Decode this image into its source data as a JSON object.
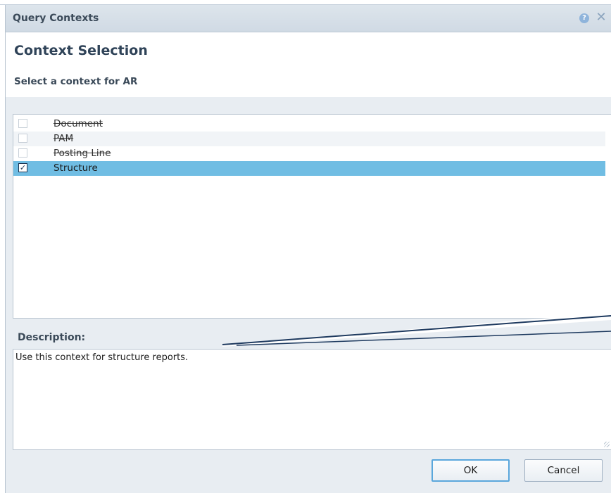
{
  "dialog": {
    "title": "Query Contexts",
    "help_icon": "help-icon",
    "close_icon": "close-icon",
    "close_glyph": "✕"
  },
  "header": {
    "heading": "Context Selection",
    "subheading": "Select a context for AR"
  },
  "contexts": [
    {
      "label": "Document",
      "checked": false,
      "disabled": true
    },
    {
      "label": "PAM",
      "checked": false,
      "disabled": true
    },
    {
      "label": "Posting Line",
      "checked": false,
      "disabled": true
    },
    {
      "label": "Structure",
      "checked": true,
      "disabled": false
    }
  ],
  "description": {
    "label": "Description:",
    "text": "Use this context for structure reports."
  },
  "buttons": {
    "ok": "OK",
    "cancel": "Cancel"
  },
  "colors": {
    "selected_row": "#70bde3",
    "titlebar": "#d6dfe8",
    "ok_focus_border": "#5aa7dc",
    "callout_line": "#1e3a5f"
  }
}
